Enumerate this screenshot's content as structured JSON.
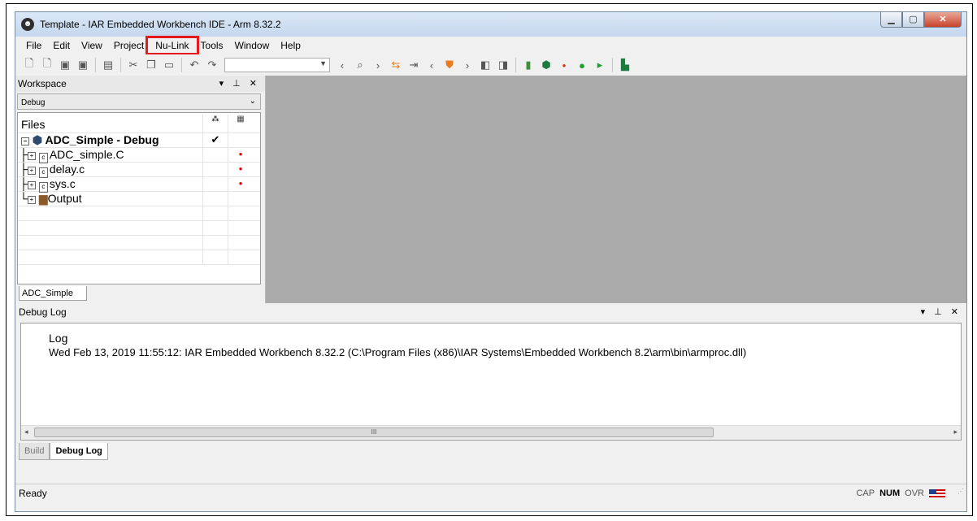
{
  "window": {
    "title": "Template - IAR Embedded Workbench IDE - Arm 8.32.2"
  },
  "menu": [
    "File",
    "Edit",
    "View",
    "Project",
    "Nu-Link",
    "Tools",
    "Window",
    "Help"
  ],
  "workspace": {
    "header": "Workspace",
    "config": "Debug",
    "files_header": "Files",
    "project": "ADC_Simple - Debug",
    "files": [
      "ADC_simple.C",
      "delay.c",
      "sys.c",
      "Output"
    ],
    "tab": "ADC_Simple"
  },
  "debug_log": {
    "header": "Debug Log",
    "log_header": "Log",
    "line": "Wed Feb 13, 2019 11:55:12: IAR Embedded Workbench 8.32.2 (C:\\Program Files (x86)\\IAR Systems\\Embedded Workbench 8.2\\arm\\bin\\armproc.dll)",
    "tabs": [
      "Build",
      "Debug Log"
    ]
  },
  "status": {
    "text": "Ready",
    "cap": "CAP",
    "num": "NUM",
    "ovr": "OVR"
  },
  "colors": {
    "highlight": "#e6191f",
    "editor_bg": "#ababab"
  }
}
